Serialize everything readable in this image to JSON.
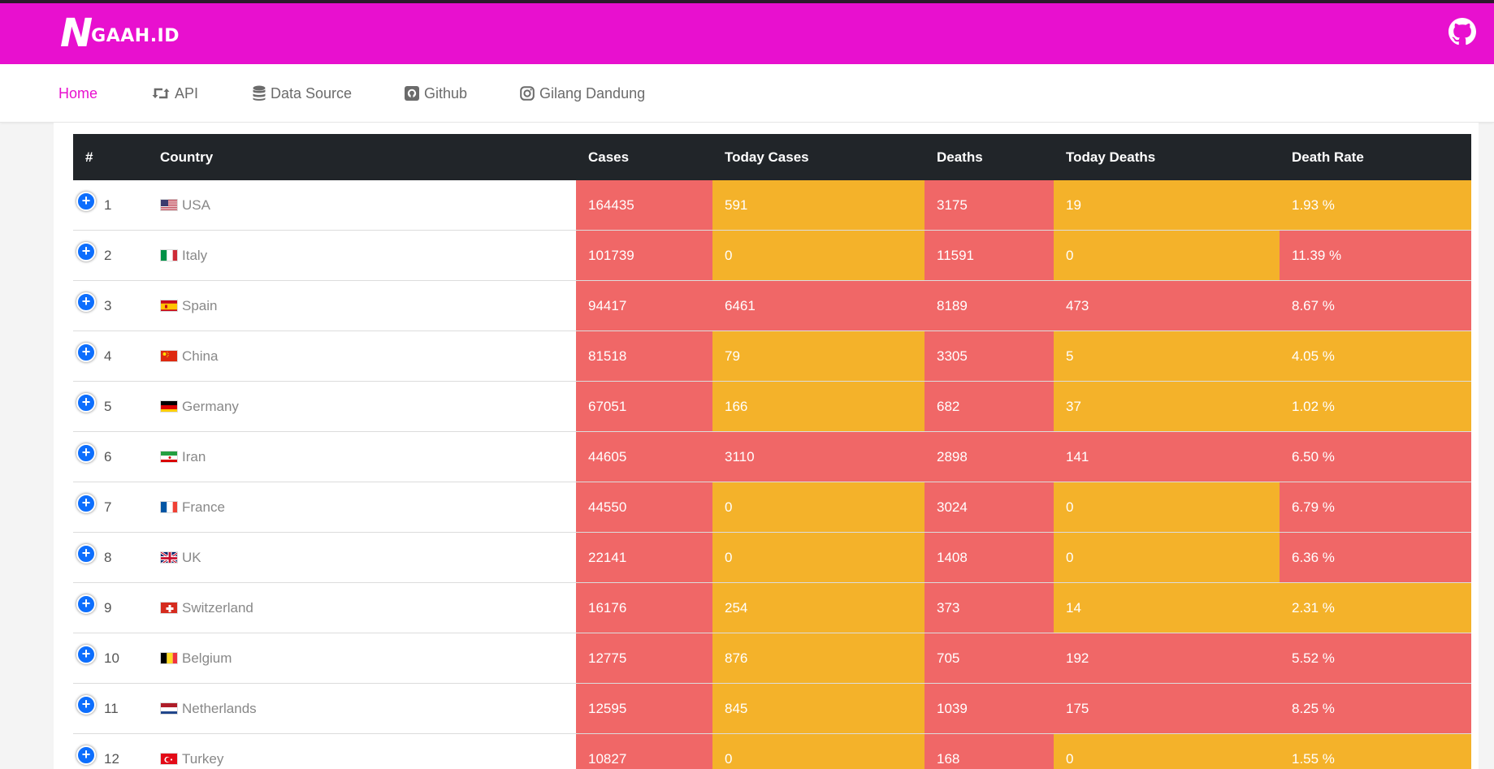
{
  "brand": {
    "logo_n": "N",
    "logo_rest": "GAAH.ID"
  },
  "nav": {
    "items": [
      {
        "label": "Home",
        "icon": "none",
        "active": true
      },
      {
        "label": "API",
        "icon": "retweet-icon",
        "active": false
      },
      {
        "label": "Data Source",
        "icon": "database-icon",
        "active": false
      },
      {
        "label": "Github",
        "icon": "github-square-icon",
        "active": false
      },
      {
        "label": "Gilang Dandung",
        "icon": "instagram-icon",
        "active": false
      }
    ]
  },
  "table": {
    "headers": [
      "#",
      "Country",
      "Cases",
      "Today Cases",
      "Deaths",
      "Today Deaths",
      "Death Rate"
    ],
    "rows": [
      {
        "rank": "1",
        "country": "USA",
        "flag": "us-flag-icon",
        "cases": "164435",
        "today_cases": "591",
        "deaths": "3175",
        "today_deaths": "19",
        "death_rate": "1.93 %",
        "colors": [
          "red",
          "orange",
          "red",
          "orange",
          "orange"
        ]
      },
      {
        "rank": "2",
        "country": "Italy",
        "flag": "it-flag-icon",
        "cases": "101739",
        "today_cases": "0",
        "deaths": "11591",
        "today_deaths": "0",
        "death_rate": "11.39 %",
        "colors": [
          "red",
          "orange",
          "red",
          "orange",
          "red"
        ]
      },
      {
        "rank": "3",
        "country": "Spain",
        "flag": "es-flag-icon",
        "cases": "94417",
        "today_cases": "6461",
        "deaths": "8189",
        "today_deaths": "473",
        "death_rate": "8.67 %",
        "colors": [
          "red",
          "red",
          "red",
          "red",
          "red"
        ]
      },
      {
        "rank": "4",
        "country": "China",
        "flag": "cn-flag-icon",
        "cases": "81518",
        "today_cases": "79",
        "deaths": "3305",
        "today_deaths": "5",
        "death_rate": "4.05 %",
        "colors": [
          "red",
          "orange",
          "red",
          "orange",
          "orange"
        ]
      },
      {
        "rank": "5",
        "country": "Germany",
        "flag": "de-flag-icon",
        "cases": "67051",
        "today_cases": "166",
        "deaths": "682",
        "today_deaths": "37",
        "death_rate": "1.02 %",
        "colors": [
          "red",
          "orange",
          "red",
          "orange",
          "orange"
        ]
      },
      {
        "rank": "6",
        "country": "Iran",
        "flag": "ir-flag-icon",
        "cases": "44605",
        "today_cases": "3110",
        "deaths": "2898",
        "today_deaths": "141",
        "death_rate": "6.50 %",
        "colors": [
          "red",
          "red",
          "red",
          "red",
          "red"
        ]
      },
      {
        "rank": "7",
        "country": "France",
        "flag": "fr-flag-icon",
        "cases": "44550",
        "today_cases": "0",
        "deaths": "3024",
        "today_deaths": "0",
        "death_rate": "6.79 %",
        "colors": [
          "red",
          "orange",
          "red",
          "orange",
          "red"
        ]
      },
      {
        "rank": "8",
        "country": "UK",
        "flag": "gb-flag-icon",
        "cases": "22141",
        "today_cases": "0",
        "deaths": "1408",
        "today_deaths": "0",
        "death_rate": "6.36 %",
        "colors": [
          "red",
          "orange",
          "red",
          "orange",
          "red"
        ]
      },
      {
        "rank": "9",
        "country": "Switzerland",
        "flag": "ch-flag-icon",
        "cases": "16176",
        "today_cases": "254",
        "deaths": "373",
        "today_deaths": "14",
        "death_rate": "2.31 %",
        "colors": [
          "red",
          "orange",
          "red",
          "orange",
          "orange"
        ]
      },
      {
        "rank": "10",
        "country": "Belgium",
        "flag": "be-flag-icon",
        "cases": "12775",
        "today_cases": "876",
        "deaths": "705",
        "today_deaths": "192",
        "death_rate": "5.52 %",
        "colors": [
          "red",
          "orange",
          "red",
          "red",
          "red"
        ]
      },
      {
        "rank": "11",
        "country": "Netherlands",
        "flag": "nl-flag-icon",
        "cases": "12595",
        "today_cases": "845",
        "deaths": "1039",
        "today_deaths": "175",
        "death_rate": "8.25 %",
        "colors": [
          "red",
          "orange",
          "red",
          "red",
          "red"
        ]
      },
      {
        "rank": "12",
        "country": "Turkey",
        "flag": "tr-flag-icon",
        "cases": "10827",
        "today_cases": "0",
        "deaths": "168",
        "today_deaths": "0",
        "death_rate": "1.55 %",
        "colors": [
          "red",
          "orange",
          "red",
          "orange",
          "orange"
        ]
      }
    ]
  },
  "colors": {
    "brand": "#e810cf",
    "header_bg": "#212529",
    "red": "#f06767",
    "orange": "#f4b22a",
    "expand_button": "#0d6efd"
  }
}
